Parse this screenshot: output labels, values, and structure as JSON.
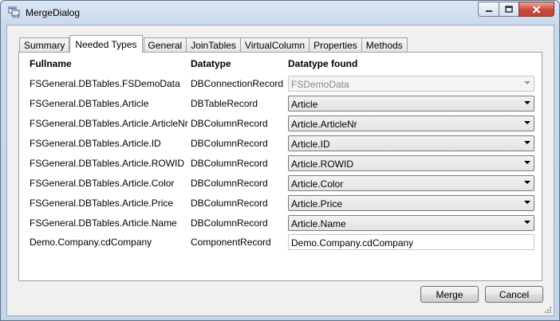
{
  "window": {
    "title": "MergeDialog",
    "minimize_icon": "minimize-icon",
    "maximize_icon": "maximize-icon",
    "close_icon": "close-icon"
  },
  "tabs": [
    {
      "label": "Summary"
    },
    {
      "label": "Needed Types"
    },
    {
      "label": "General"
    },
    {
      "label": "JoinTables"
    },
    {
      "label": "VirtualColumn"
    },
    {
      "label": "Properties"
    },
    {
      "label": "Methods"
    }
  ],
  "active_tab": "Needed Types",
  "table": {
    "headers": {
      "fullname": "Fullname",
      "datatype": "Datatype",
      "found": "Datatype found"
    },
    "rows": [
      {
        "fullname": "FSGeneral.DBTables.FSDemoData",
        "datatype": "DBConnectionRecord",
        "found": "FSDemoData"
      },
      {
        "fullname": "FSGeneral.DBTables.Article",
        "datatype": "DBTableRecord",
        "found": "Article"
      },
      {
        "fullname": "FSGeneral.DBTables.Article.ArticleNr",
        "datatype": "DBColumnRecord",
        "found": "Article.ArticleNr"
      },
      {
        "fullname": "FSGeneral.DBTables.Article.ID",
        "datatype": "DBColumnRecord",
        "found": "Article.ID"
      },
      {
        "fullname": "FSGeneral.DBTables.Article.ROWID",
        "datatype": "DBColumnRecord",
        "found": "Article.ROWID"
      },
      {
        "fullname": "FSGeneral.DBTables.Article.Color",
        "datatype": "DBColumnRecord",
        "found": "Article.Color"
      },
      {
        "fullname": "FSGeneral.DBTables.Article.Price",
        "datatype": "DBColumnRecord",
        "found": "Article.Price"
      },
      {
        "fullname": "FSGeneral.DBTables.Article.Name",
        "datatype": "DBColumnRecord",
        "found": "Article.Name"
      },
      {
        "fullname": "Demo.Company.cdCompany",
        "datatype": "ComponentRecord",
        "found": "Demo.Company.cdCompany"
      }
    ]
  },
  "buttons": {
    "merge": "Merge",
    "cancel": "Cancel"
  }
}
